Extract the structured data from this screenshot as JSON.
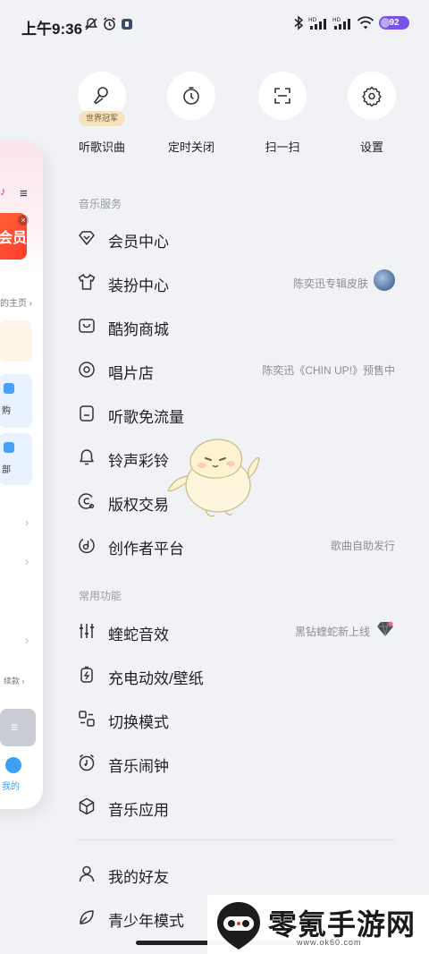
{
  "status": {
    "time": "上午9:36",
    "battery": "92",
    "left_icons": [
      "mute-icon",
      "alarm-icon",
      "app-notification-icon"
    ],
    "right_icons": [
      "bluetooth-icon",
      "hd-signal-icon",
      "hd-signal-icon",
      "wifi-icon",
      "battery-icon"
    ]
  },
  "side_card": {
    "promo_text": "会员",
    "home_link": "的主页 ›",
    "labels": [
      "购",
      "部",
      "续款 ›",
      "我的"
    ]
  },
  "quick_actions": [
    {
      "label": "听歌识曲",
      "icon": "mic-listen-icon",
      "badge": "世界冠军"
    },
    {
      "label": "定时关闭",
      "icon": "timer-icon"
    },
    {
      "label": "扫一扫",
      "icon": "scan-icon"
    },
    {
      "label": "设置",
      "icon": "gear-icon"
    }
  ],
  "music_services": {
    "title": "音乐服务",
    "items": [
      {
        "label": "会员中心",
        "icon": "diamond-icon",
        "right": ""
      },
      {
        "label": "装扮中心",
        "icon": "tshirt-icon",
        "right": "陈奕迅专辑皮肤"
      },
      {
        "label": "酷狗商城",
        "icon": "shop-icon",
        "right": ""
      },
      {
        "label": "唱片店",
        "icon": "vinyl-icon",
        "right": "陈奕迅《CHIN UP!》预售中"
      },
      {
        "label": "听歌免流量",
        "icon": "sim-card-icon",
        "right": ""
      },
      {
        "label": "铃声彩铃",
        "icon": "bell-icon",
        "right": ""
      },
      {
        "label": "版权交易",
        "icon": "copyright-icon",
        "right": ""
      },
      {
        "label": "创作者平台",
        "icon": "music-note-circle-icon",
        "right": "歌曲自助发行"
      }
    ]
  },
  "common_functions": {
    "title": "常用功能",
    "items": [
      {
        "label": "蝰蛇音效",
        "icon": "equalizer-icon",
        "right": "黑钻蝰蛇新上线"
      },
      {
        "label": "充电动效/壁纸",
        "icon": "charging-icon",
        "right": ""
      },
      {
        "label": "切换模式",
        "icon": "switch-mode-icon",
        "right": ""
      },
      {
        "label": "音乐闹钟",
        "icon": "music-alarm-icon",
        "right": ""
      },
      {
        "label": "音乐应用",
        "icon": "cube-icon",
        "right": ""
      }
    ]
  },
  "other_items": [
    {
      "label": "我的好友",
      "icon": "person-icon"
    },
    {
      "label": "青少年模式",
      "icon": "leaf-icon"
    }
  ],
  "watermark": {
    "title": "零氪手游网",
    "url": "www.ok60.com"
  }
}
